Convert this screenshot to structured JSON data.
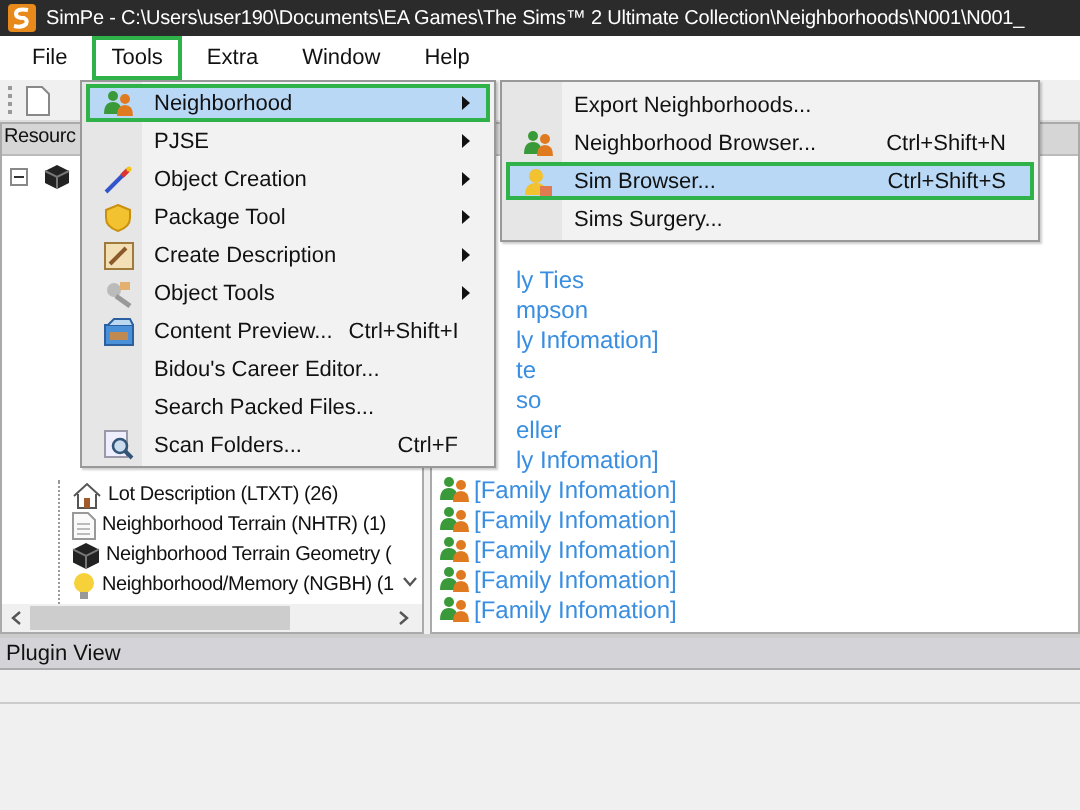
{
  "window": {
    "title": "SimPe - C:\\Users\\user190\\Documents\\EA Games\\The Sims™ 2 Ultimate Collection\\Neighborhoods\\N001\\N001_"
  },
  "menu_bar": [
    {
      "label": "File",
      "selected": false
    },
    {
      "label": "Tools",
      "selected": true
    },
    {
      "label": "Extra",
      "selected": false
    },
    {
      "label": "Window",
      "selected": false
    },
    {
      "label": "Help",
      "selected": false
    }
  ],
  "tools_menu": [
    {
      "label": "Neighborhood",
      "submenu": true,
      "selected": true
    },
    {
      "label": "PJSE",
      "submenu": true,
      "selected": false
    },
    {
      "label": "Object Creation",
      "submenu": true,
      "selected": false
    },
    {
      "label": "Package Tool",
      "submenu": true,
      "selected": false
    },
    {
      "label": "Create Description",
      "submenu": true,
      "selected": false
    },
    {
      "label": "Object Tools",
      "submenu": true,
      "selected": false
    },
    {
      "label": "Content Preview...",
      "shortcut": "Ctrl+Shift+I",
      "submenu": false,
      "selected": false
    },
    {
      "label": "Bidou's Career Editor...",
      "submenu": false,
      "selected": false
    },
    {
      "label": "Search Packed Files...",
      "submenu": false,
      "selected": false
    },
    {
      "label": "Scan Folders...",
      "shortcut": "Ctrl+F",
      "submenu": false,
      "selected": false
    }
  ],
  "neighborhood_submenu": [
    {
      "label": "Export Neighborhoods...",
      "selected": false
    },
    {
      "label": "Neighborhood Browser...",
      "shortcut": "Ctrl+Shift+N",
      "selected": false
    },
    {
      "label": "Sim Browser...",
      "shortcut": "Ctrl+Shift+S",
      "selected": true
    },
    {
      "label": "Sims Surgery...",
      "selected": false
    }
  ],
  "left_panel": {
    "header": "Resourc",
    "tree": [
      {
        "label": "Lot Description (LTXT) (26)"
      },
      {
        "label": "Neighborhood Terrain (NHTR) (1)"
      },
      {
        "label": "Neighborhood Terrain Geometry ("
      },
      {
        "label": "Neighborhood/Memory (NGBH) (1"
      }
    ]
  },
  "right_panel": {
    "partially_hidden_rows": [
      "ly Ties",
      "mpson",
      "ly Infomation]",
      "te",
      "so",
      "eller",
      "ly Infomation]"
    ],
    "rows": [
      "[Family Infomation]",
      "[Family Infomation]",
      "[Family Infomation]",
      "[Family Infomation]",
      "[Family Infomation]"
    ]
  },
  "plugin_view": {
    "title": "Plugin View"
  }
}
